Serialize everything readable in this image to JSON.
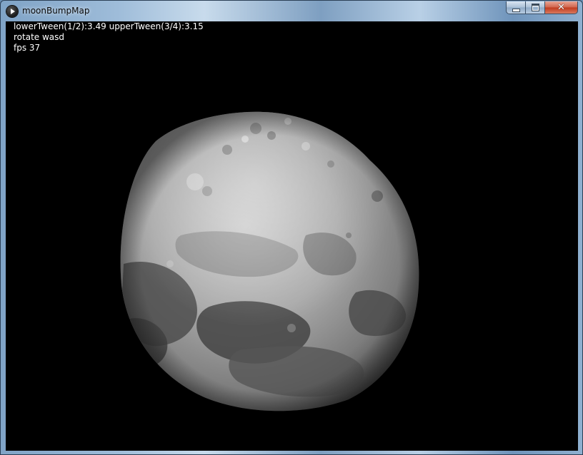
{
  "window": {
    "title": "moonBumpMap",
    "minimize_glyph": "minimize-icon",
    "maximize_glyph": "maximize-icon",
    "close_glyph": "✕"
  },
  "hud": {
    "line1": "lowerTween(1/2):3.49 upperTween(3/4):3.15",
    "line2": "rotate wasd",
    "line3": "fps 37"
  },
  "colors": {
    "canvas_background": "#000000",
    "hud_text": "#ffffff",
    "close_button": "#c0391c"
  }
}
